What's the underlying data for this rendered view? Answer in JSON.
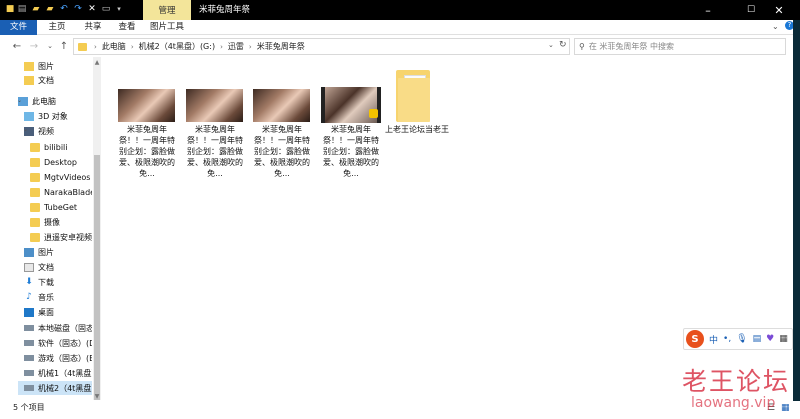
{
  "titlebar": {
    "context_tab": "管理",
    "title": "米菲兔周年祭",
    "minimize": "–",
    "maximize": "☐",
    "close": "✕"
  },
  "ribbon": {
    "tabs": [
      "文件",
      "主页",
      "共享",
      "查看",
      "图片工具"
    ]
  },
  "address": {
    "crumbs": [
      "此电脑",
      "机械2（4t黑盘）(G:)",
      "迅雷",
      "米菲兔周年祭"
    ],
    "search_placeholder": "在 米菲兔周年祭 中搜索"
  },
  "nav": {
    "items": [
      {
        "label": "图片",
        "icon": "pin"
      },
      {
        "label": "文档",
        "icon": "pin"
      },
      {
        "label": "此电脑",
        "icon": "pc"
      },
      {
        "label": "3D 对象",
        "icon": "cube"
      },
      {
        "label": "视频",
        "icon": "film"
      },
      {
        "label": "bilibili",
        "icon": "folder"
      },
      {
        "label": "Desktop",
        "icon": "folder"
      },
      {
        "label": "MgtvVideos",
        "icon": "folder"
      },
      {
        "label": "NarakaBladepo",
        "icon": "folder"
      },
      {
        "label": "TubeGet",
        "icon": "folder"
      },
      {
        "label": "摄像",
        "icon": "folder"
      },
      {
        "label": "逍遥安卓视频",
        "icon": "folder"
      },
      {
        "label": "图片",
        "icon": "pic"
      },
      {
        "label": "文档",
        "icon": "doc"
      },
      {
        "label": "下载",
        "icon": "down"
      },
      {
        "label": "音乐",
        "icon": "music"
      },
      {
        "label": "桌面",
        "icon": "desk"
      },
      {
        "label": "本地磁盘（固态）",
        "icon": "drive"
      },
      {
        "label": "软件（固态）(D",
        "icon": "drive"
      },
      {
        "label": "游戏（固态）(E",
        "icon": "drive"
      },
      {
        "label": "机械1（4t黑盘）",
        "icon": "drive"
      },
      {
        "label": "机械2（4t黑盘）",
        "icon": "drive"
      }
    ]
  },
  "files": [
    {
      "caption": "米菲兔周年祭！！一周年特别企划：露脸做爱、极限潮吹的免...",
      "type": "image"
    },
    {
      "caption": "米菲兔周年祭！！一周年特别企划：露脸做爱、极限潮吹的免...",
      "type": "image"
    },
    {
      "caption": "米菲兔周年祭！！一周年特别企划：露脸做爱、极限潮吹的免...",
      "type": "image"
    },
    {
      "caption": "米菲兔周年祭！！一周年特别企划：露脸做爱、极限潮吹的免...",
      "type": "video"
    },
    {
      "caption": "上老王论坛当老王",
      "type": "folder"
    }
  ],
  "status": {
    "count": "5 个项目"
  },
  "ime": {
    "logo": "S",
    "mode": "中"
  },
  "watermark": {
    "text": "老王论坛",
    "url": "laowang.vip"
  }
}
